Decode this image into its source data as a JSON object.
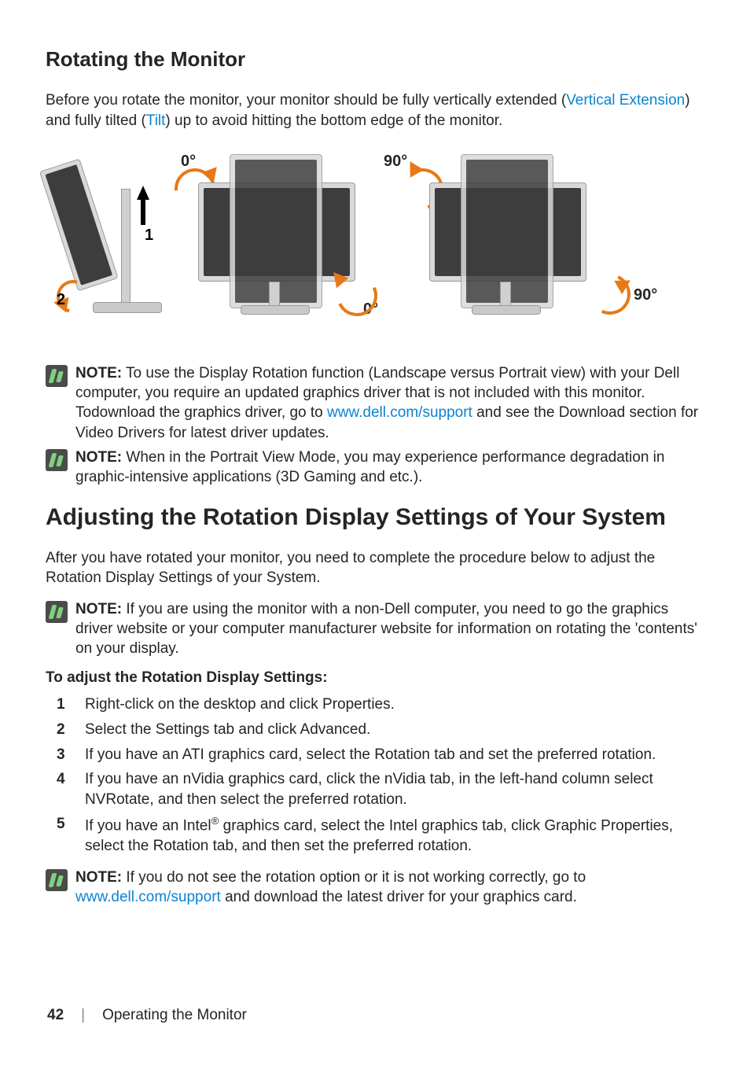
{
  "h2": "Rotating the Monitor",
  "intro_pre": "Before you rotate the monitor, your monitor should be fully vertically extended (",
  "intro_link1": "Vertical Extension",
  "intro_mid": ") and fully tilted (",
  "intro_link2": "Tilt",
  "intro_post": ") up to avoid hitting the bottom edge of the monitor.",
  "fig": {
    "deg0_a": "0°",
    "deg90_a": "90°",
    "deg0_b": "0°",
    "deg90_b": "90°",
    "n1": "1",
    "n2": "2"
  },
  "note1_label": "NOTE:",
  "note1_body_a": " To use the Display Rotation function (Landscape versus Portrait view) with your Dell computer, you require an updated graphics driver that is not included with this monitor. Todownload the graphics driver, go to ",
  "note1_link": "www.dell.com/support",
  "note1_body_b": " and see the Download section for Video Drivers for latest driver updates.",
  "note2_label": "NOTE:",
  "note2_body": " When in the Portrait View Mode, you may experience performance degradation in graphic-intensive applications (3D Gaming and etc.).",
  "h1": "Adjusting the Rotation Display Settings of Your System",
  "p2": "After you have rotated your monitor, you need to complete the procedure below to adjust the Rotation Display Settings of your System.",
  "note3_label": "NOTE:",
  "note3_body": " If you are using the monitor with a non-Dell computer, you need to go the graphics driver website or your computer manufacturer website for information on rotating the 'contents' on your display.",
  "proc_title": "To adjust the Rotation Display Settings:",
  "steps": [
    {
      "n": "1",
      "t": "Right-click on the desktop and click Properties."
    },
    {
      "n": "2",
      "t": "Select the Settings tab and click Advanced."
    },
    {
      "n": "3",
      "t": "If you have an ATI graphics card, select the Rotation tab and set the preferred rotation."
    },
    {
      "n": "4",
      "t": "If you have an nVidia graphics card, click the nVidia tab, in the left-hand column select NVRotate, and then select the preferred rotation."
    },
    {
      "n": "5",
      "t_pre": "If you have an Intel",
      "t_sup": "®",
      "t_post": " graphics card, select the Intel graphics tab, click Graphic Properties, select the Rotation tab, and then set the preferred rotation."
    }
  ],
  "note4_label": "NOTE:",
  "note4_a": " If you do not see the rotation option or it is not working correctly, go to ",
  "note4_link": "www.dell.com/support",
  "note4_b": " and download the latest driver for your graphics card.",
  "footer_page": "42",
  "footer_sep": "|",
  "footer_chapter": "Operating the Monitor"
}
